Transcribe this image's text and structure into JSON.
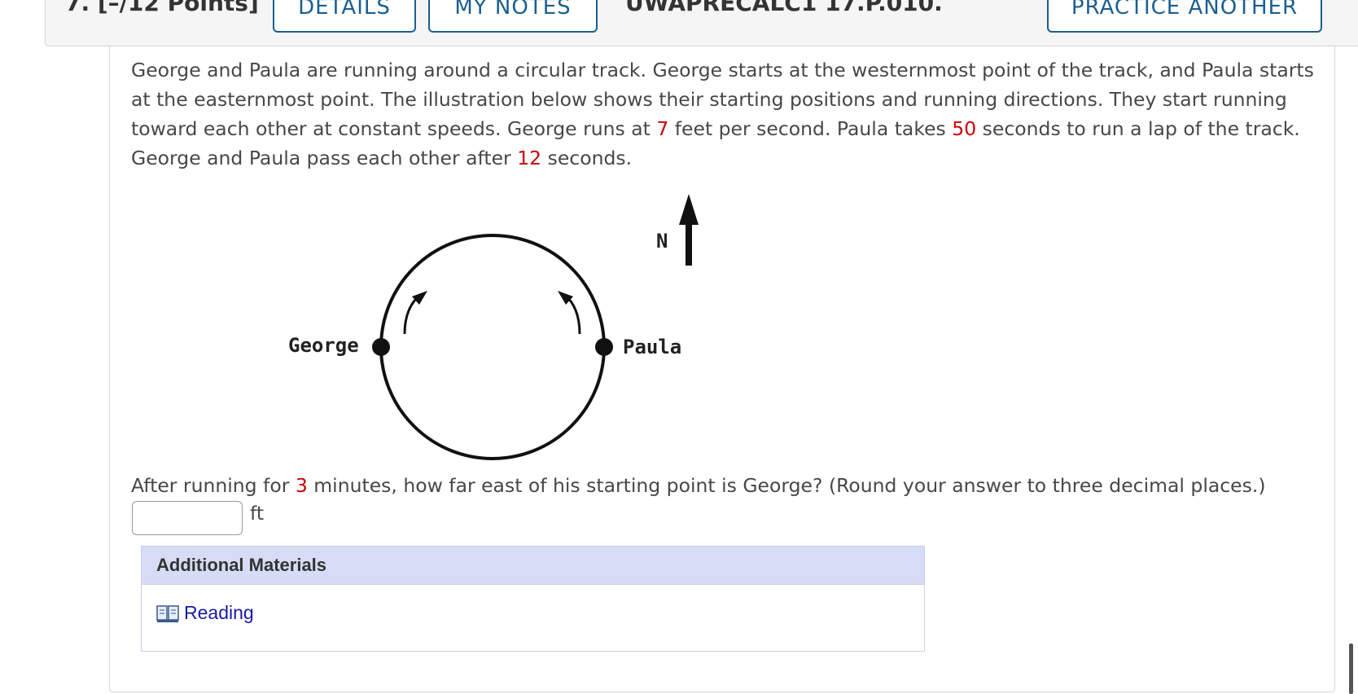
{
  "header": {
    "question_title": "7.  [–/12 Points]",
    "details_label": "DETAILS",
    "my_notes_label": "MY NOTES",
    "question_id": "UWAPRECALC1 17.P.010.",
    "practice_label": "PRACTICE ANOTHER"
  },
  "problem": {
    "p1": "George and Paula are running around a circular track. George starts at the westernmost point of the track, and Paula starts at the easternmost point. The illustration below shows their starting positions and running directions. They start running toward each other at constant speeds. George runs at ",
    "speed": "7",
    "p2": " feet per second. Paula takes ",
    "lap_time": "50",
    "p3": " seconds to run a lap of the track. George and Paula pass each other after ",
    "pass_time": "12",
    "p4": " seconds."
  },
  "diagram": {
    "north_label": "N",
    "george_label": "George",
    "paula_label": "Paula"
  },
  "question": {
    "q1": "After running for ",
    "minutes": "3",
    "q2": " minutes, how far east of his starting point is George? (Round your answer to three decimal places.)",
    "answer_value": "",
    "unit": "ft"
  },
  "materials": {
    "title": "Additional Materials",
    "reading_label": "Reading"
  },
  "colors": {
    "accent": "#1a5f8f",
    "highlight_red": "#cc0000",
    "materials_header_bg": "#d6dcf5",
    "link": "#1a1aa6"
  }
}
